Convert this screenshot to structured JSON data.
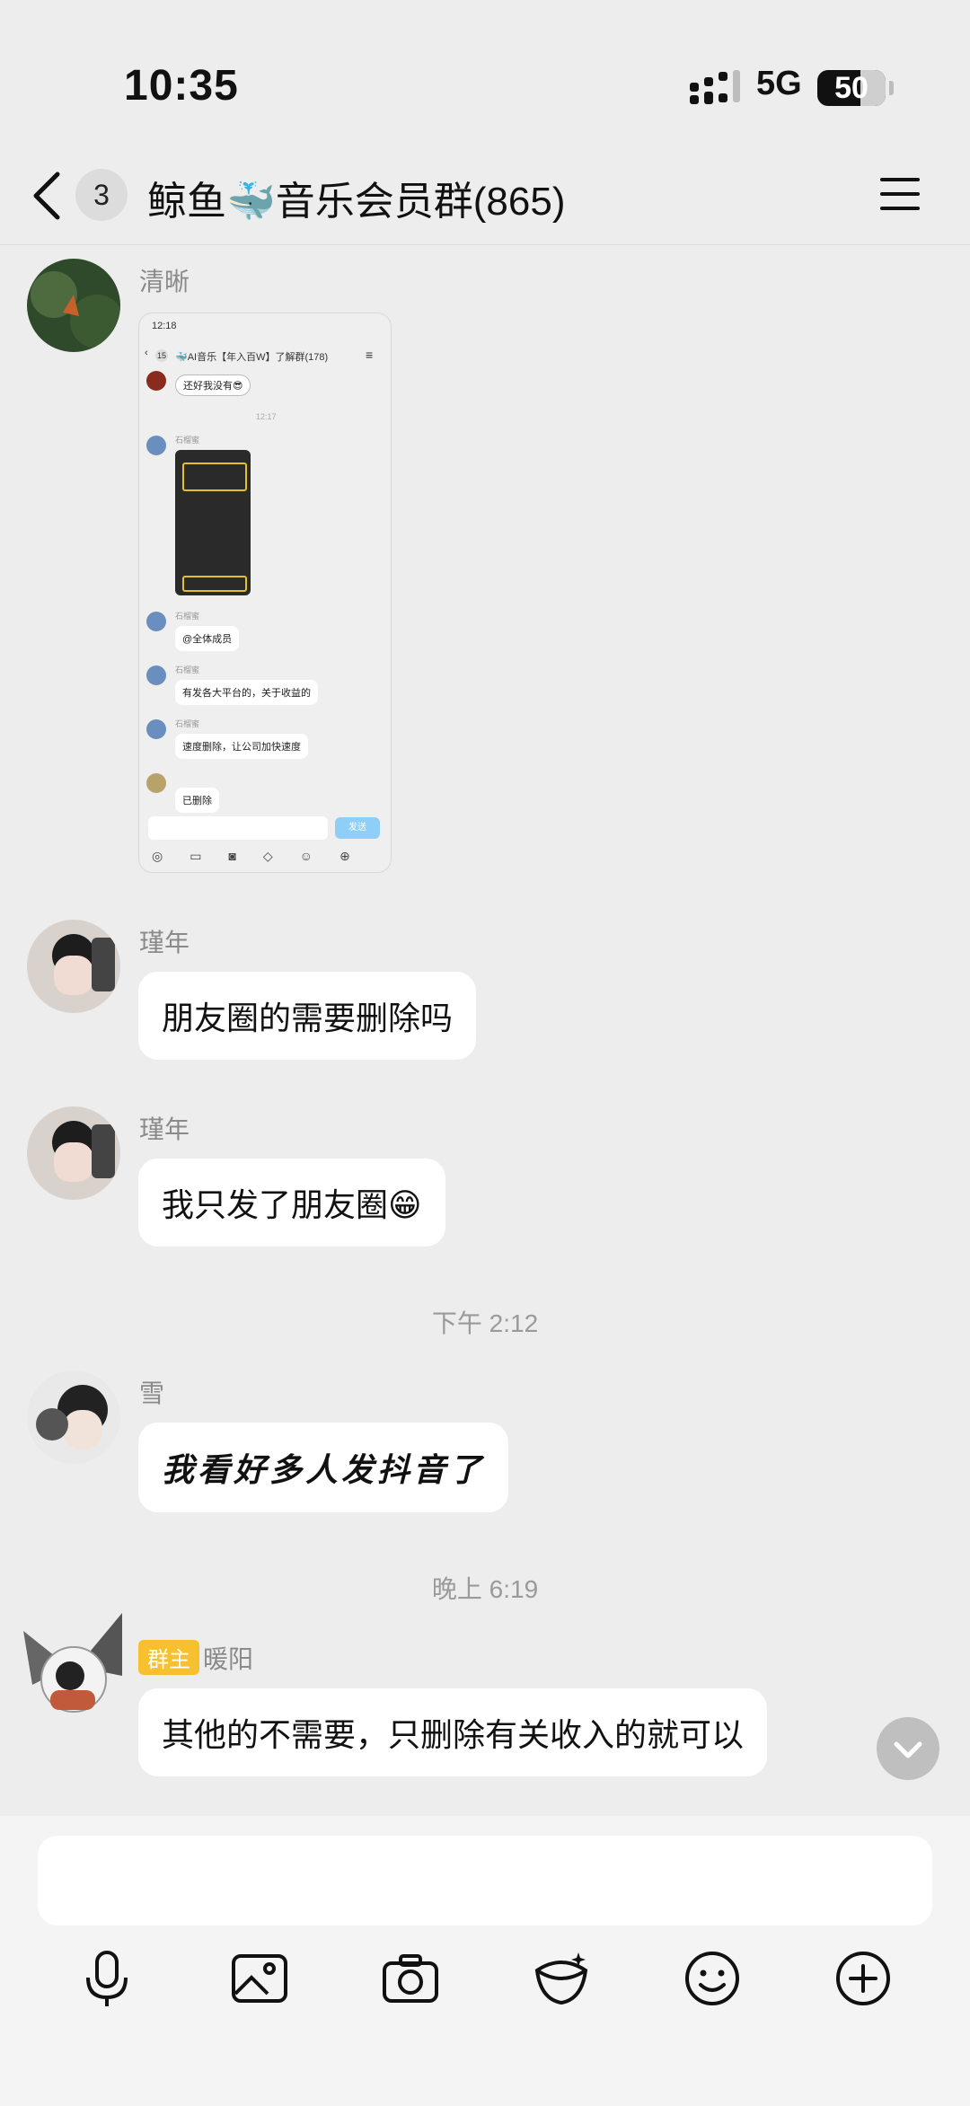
{
  "status_bar": {
    "time": "10:35",
    "network": "5G",
    "battery": "50"
  },
  "nav": {
    "badge_count": "3",
    "title": "鲸鱼🐳音乐会员群(865)"
  },
  "screenshot_thumb": {
    "time": "12:18",
    "badge": "15",
    "title": "🐳AI音乐【年入百W】了解群(178)",
    "first_msg": "还好我没有😎",
    "timestamp": "12:17",
    "sender": "石榴蜜",
    "messages": [
      "@全体成员",
      "有发各大平台的，关于收益的",
      "速度删除，让公司加快速度",
      "已删除"
    ],
    "send_label": "发送"
  },
  "messages": [
    {
      "sender": "清晰",
      "type": "image"
    },
    {
      "sender": "瑾年",
      "text": "朋友圈的需要删除吗"
    },
    {
      "sender": "瑾年",
      "text": "我只发了朋友圈😁"
    },
    {
      "timestamp": "下午 2:12"
    },
    {
      "sender": "雪",
      "text": "我看好多人发抖音了"
    },
    {
      "timestamp": "晚上 6:19"
    },
    {
      "sender": "暖阳",
      "role": "群主",
      "text": "其他的不需要，只删除有关收入的就可以"
    }
  ],
  "toolbar": {
    "icons": [
      "microphone-icon",
      "image-icon",
      "camera-icon",
      "red-packet-icon",
      "emoji-icon",
      "plus-icon"
    ]
  }
}
